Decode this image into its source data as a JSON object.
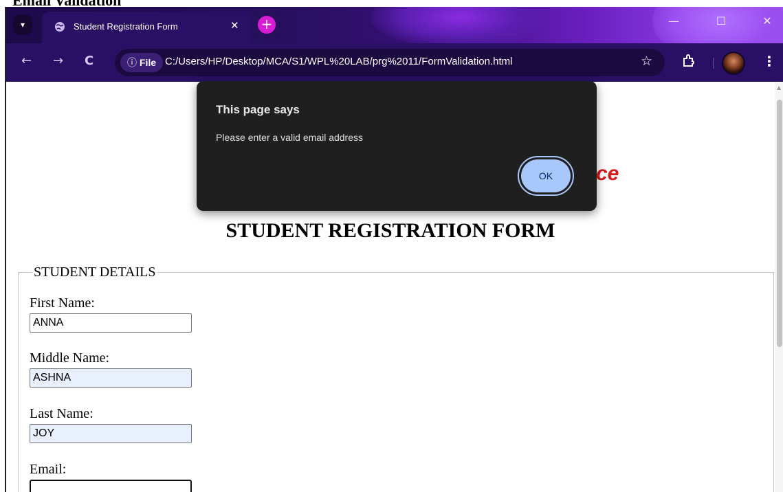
{
  "document": {
    "heading": "Email Validation"
  },
  "browser": {
    "tab": {
      "title": "Student Registration Form",
      "close": "✕"
    },
    "new_tab": "+",
    "window_controls": {
      "minimize": "—",
      "maximize": "☐",
      "close": "✕"
    },
    "nav": {
      "back": "←",
      "forward": "→",
      "reload": "C"
    },
    "omnibox": {
      "chip_icon": "ⓘ",
      "chip_label": "File",
      "url": "C:/Users/HP/Desktop/MCA/S1/WPL%20LAB/prg%2011/FormValidation.html"
    },
    "bookmark": "☆",
    "menu": "⋮",
    "icons": [
      "tab-search-icon",
      "globe-icon",
      "star-icon",
      "extensions-icon",
      "kebab-menu-icon"
    ],
    "colors": {
      "frame": "#2a1065",
      "accent": "#d81bd4"
    }
  },
  "page": {
    "logo_fragment": "ce",
    "title": "STUDENT REGISTRATION FORM",
    "fieldset_legend": "STUDENT DETAILS",
    "fields": [
      {
        "label": "First Name:",
        "value": "ANNA"
      },
      {
        "label": "Middle Name:",
        "value": "ASHNA"
      },
      {
        "label": "Last Name:",
        "value": "JOY"
      },
      {
        "label": "Email:",
        "value": ""
      }
    ]
  },
  "dialog": {
    "title": "This page says",
    "message": "Please enter a valid email address",
    "ok_label": "OK",
    "colors": {
      "background": "#1f1f1f",
      "button": "#a8c7fa"
    }
  }
}
